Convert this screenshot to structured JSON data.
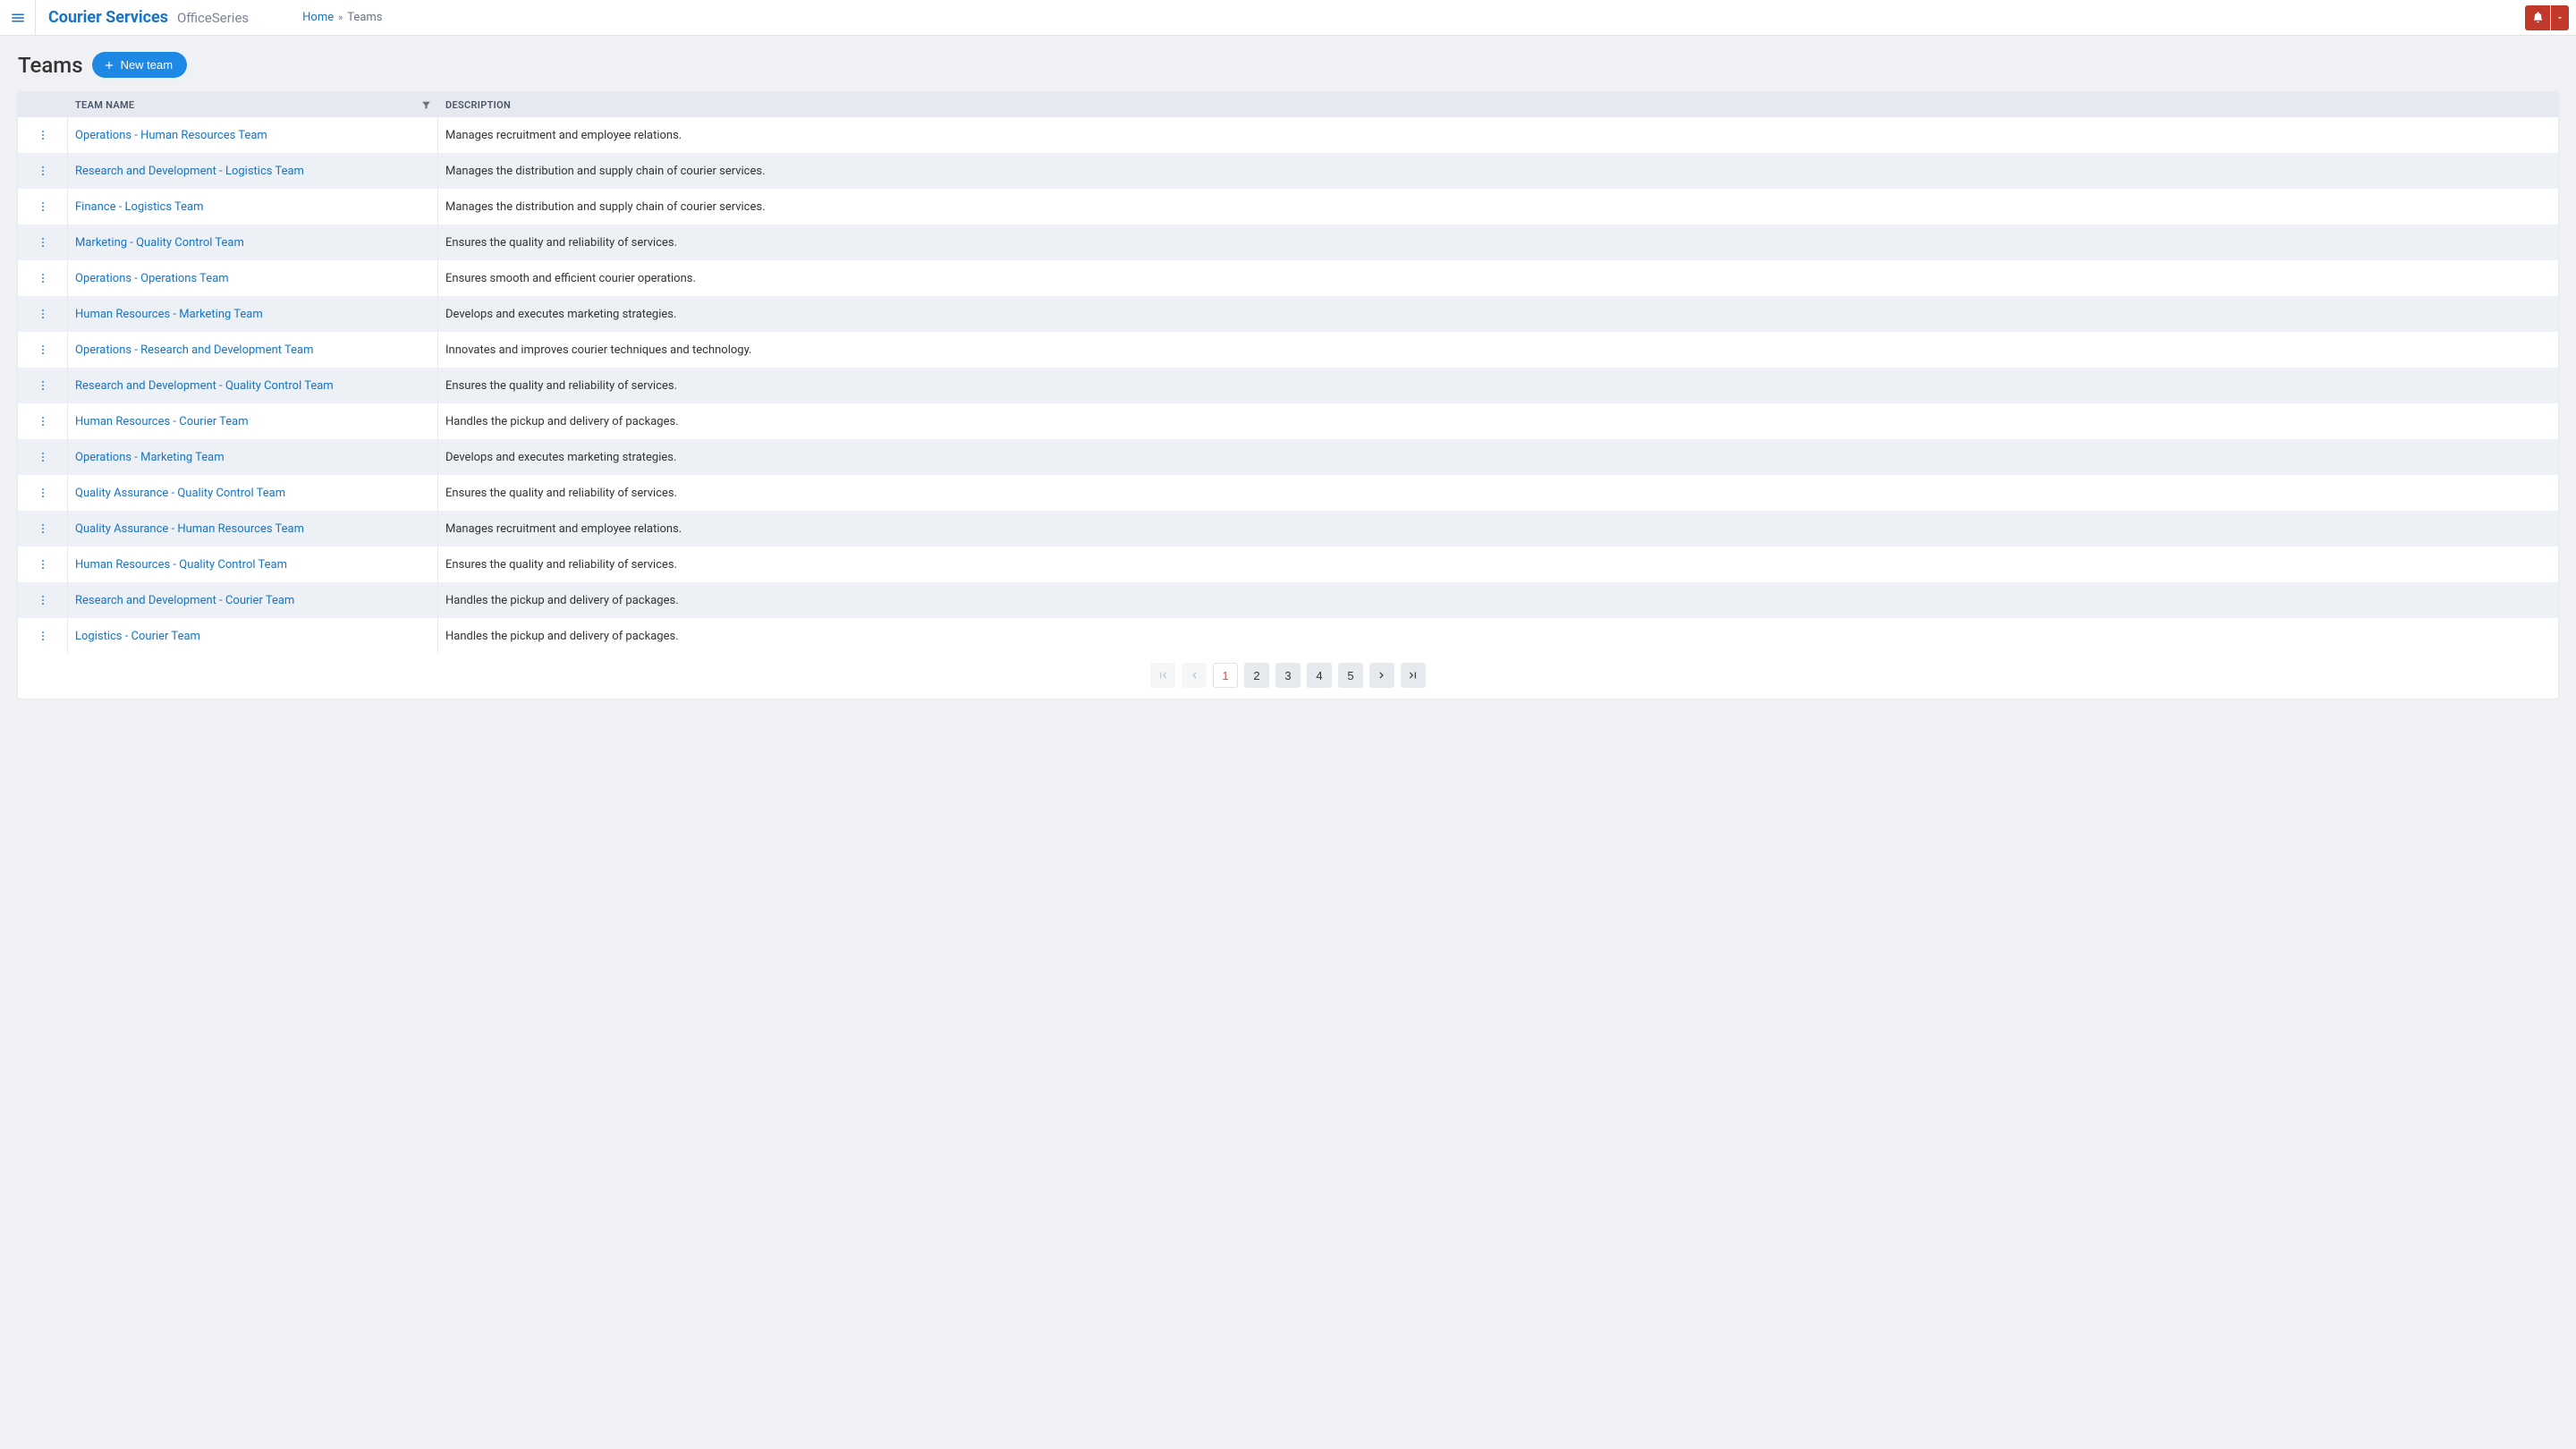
{
  "header": {
    "brand": "Courier Services",
    "brand_sub": "OfficeSeries",
    "breadcrumb": {
      "home": "Home",
      "sep": "»",
      "current": "Teams"
    }
  },
  "page": {
    "title": "Teams",
    "new_team_label": "New team"
  },
  "table": {
    "columns": {
      "name": "TEAM NAME",
      "description": "DESCRIPTION"
    },
    "rows": [
      {
        "name": "Operations - Human Resources Team",
        "description": "Manages recruitment and employee relations."
      },
      {
        "name": "Research and Development - Logistics Team",
        "description": "Manages the distribution and supply chain of courier services."
      },
      {
        "name": "Finance - Logistics Team",
        "description": "Manages the distribution and supply chain of courier services."
      },
      {
        "name": "Marketing - Quality Control Team",
        "description": "Ensures the quality and reliability of services."
      },
      {
        "name": "Operations - Operations Team",
        "description": "Ensures smooth and efficient courier operations."
      },
      {
        "name": "Human Resources - Marketing Team",
        "description": "Develops and executes marketing strategies."
      },
      {
        "name": "Operations - Research and Development Team",
        "description": "Innovates and improves courier techniques and technology."
      },
      {
        "name": "Research and Development - Quality Control Team",
        "description": "Ensures the quality and reliability of services."
      },
      {
        "name": "Human Resources - Courier Team",
        "description": "Handles the pickup and delivery of packages."
      },
      {
        "name": "Operations - Marketing Team",
        "description": "Develops and executes marketing strategies."
      },
      {
        "name": "Quality Assurance - Quality Control Team",
        "description": "Ensures the quality and reliability of services."
      },
      {
        "name": "Quality Assurance - Human Resources Team",
        "description": "Manages recruitment and employee relations."
      },
      {
        "name": "Human Resources - Quality Control Team",
        "description": "Ensures the quality and reliability of services."
      },
      {
        "name": "Research and Development - Courier Team",
        "description": "Handles the pickup and delivery of packages."
      },
      {
        "name": "Logistics - Courier Team",
        "description": "Handles the pickup and delivery of packages."
      }
    ]
  },
  "pagination": {
    "pages": [
      "1",
      "2",
      "3",
      "4",
      "5"
    ],
    "active": "1"
  }
}
